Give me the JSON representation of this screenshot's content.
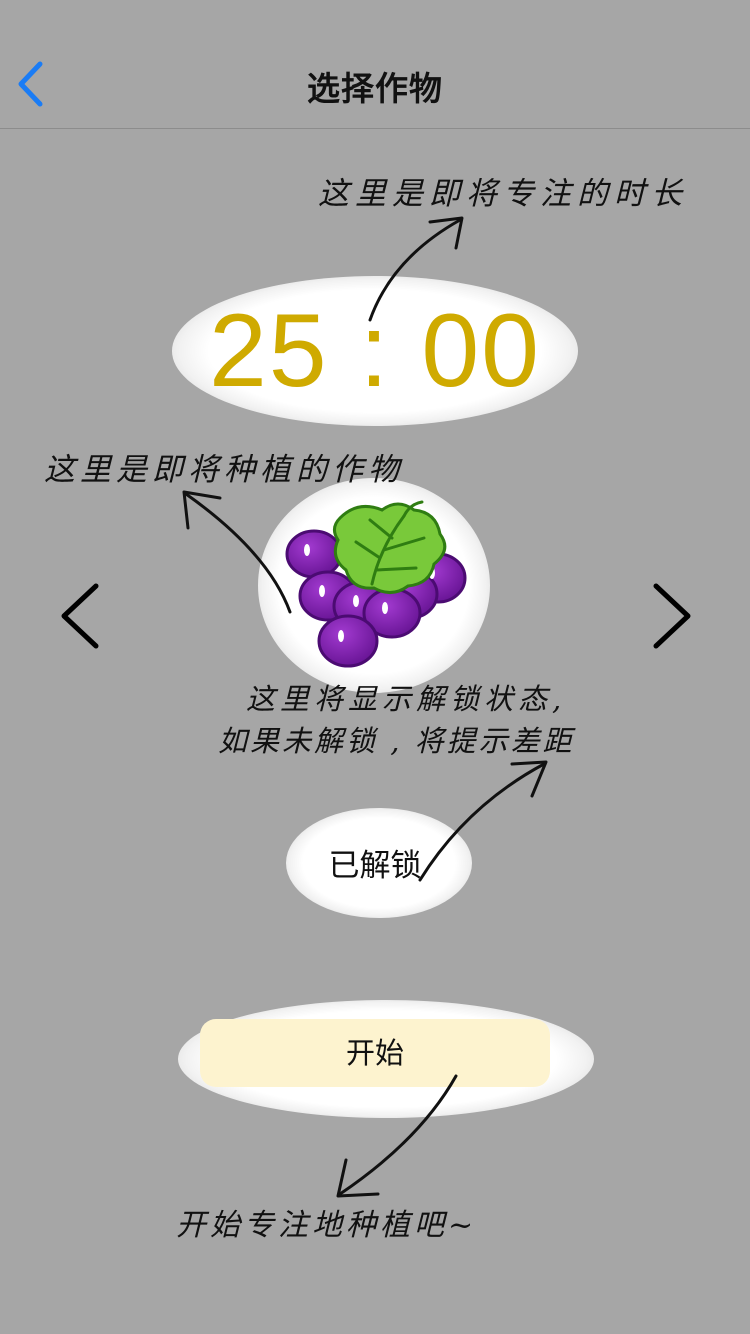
{
  "nav": {
    "title": "选择作物",
    "back_icon": "chevron-left-icon"
  },
  "timer": {
    "value": "25 : 00",
    "color": "#cfaa00"
  },
  "crop": {
    "icon": "grape-icon",
    "prev_icon": "chevron-left-icon",
    "next_icon": "chevron-right-icon"
  },
  "status": {
    "label": "已解锁"
  },
  "start_button": {
    "label": "开始",
    "color": "#fdf3cf"
  },
  "annotations": {
    "timer_note": "这里是即将专注的时长",
    "crop_note": "这里是即将种植的作物",
    "status_note_line1": "这里将显示解锁状态,",
    "status_note_line2": "如果未解锁 , 将提示差距",
    "start_note": "开始专注地种植吧~"
  },
  "colors": {
    "background": "#a6a6a6",
    "accent": "#1a7cf5",
    "grape_purple": "#7a1aa8",
    "leaf_green": "#6bbf2a"
  }
}
